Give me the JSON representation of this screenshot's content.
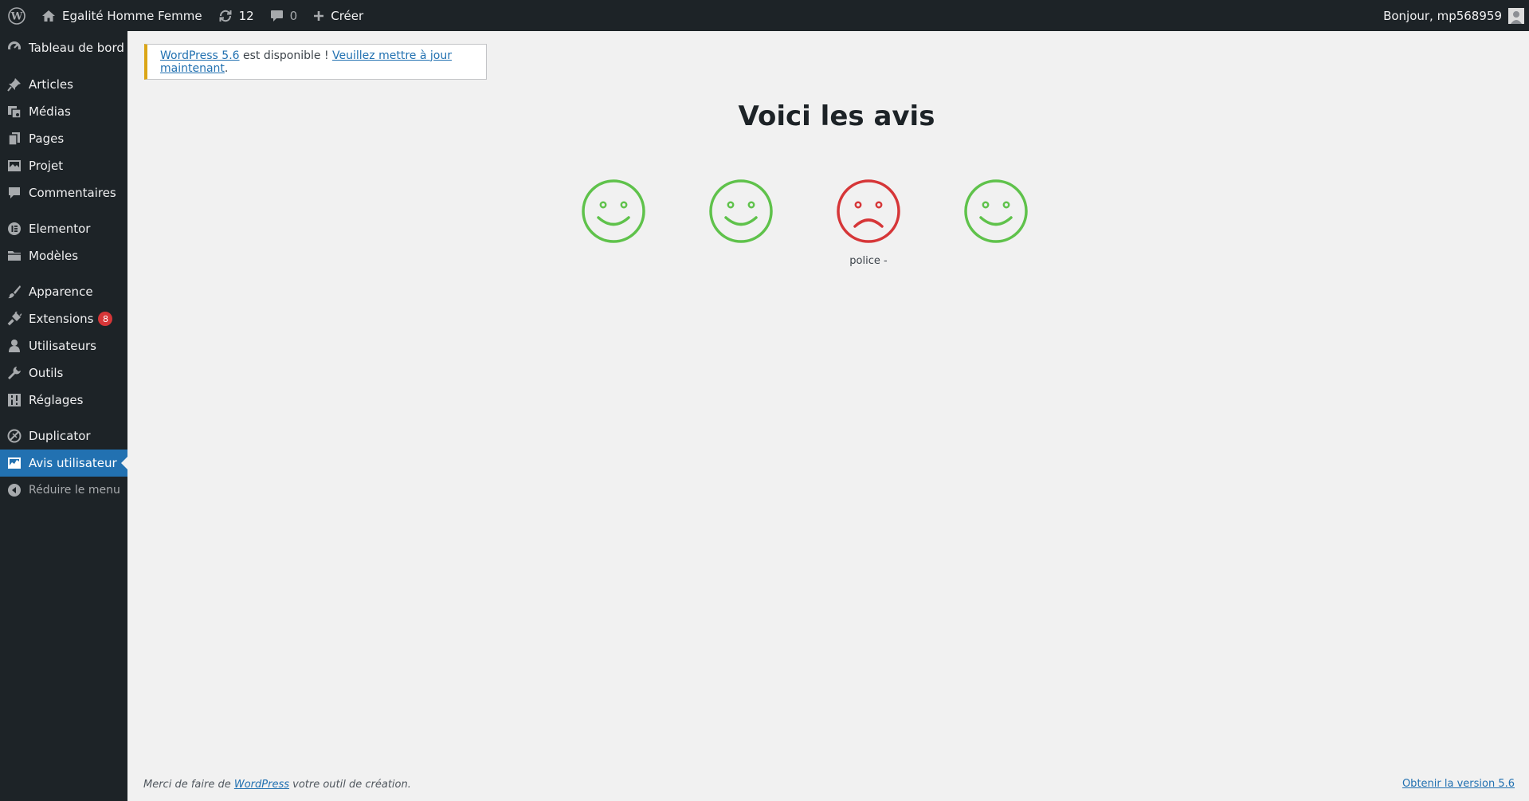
{
  "adminbar": {
    "site_name": "Egalité Homme Femme",
    "updates_count": "12",
    "comments_count": "0",
    "new_label": "Créer",
    "greeting": "Bonjour, mp568959"
  },
  "sidebar": {
    "items": [
      {
        "label": "Tableau de bord",
        "icon": "dashboard-icon"
      },
      {
        "label": "Articles",
        "icon": "pin-icon"
      },
      {
        "label": "Médias",
        "icon": "media-icon"
      },
      {
        "label": "Pages",
        "icon": "pages-icon"
      },
      {
        "label": "Projet",
        "icon": "portfolio-icon"
      },
      {
        "label": "Commentaires",
        "icon": "comment-icon"
      },
      {
        "label": "Elementor",
        "icon": "elementor-icon"
      },
      {
        "label": "Modèles",
        "icon": "folder-icon"
      },
      {
        "label": "Apparence",
        "icon": "brush-icon"
      },
      {
        "label": "Extensions",
        "icon": "plugin-icon",
        "badge": "8"
      },
      {
        "label": "Utilisateurs",
        "icon": "user-icon"
      },
      {
        "label": "Outils",
        "icon": "wrench-icon"
      },
      {
        "label": "Réglages",
        "icon": "settings-icon"
      },
      {
        "label": "Duplicator",
        "icon": "duplicator-icon"
      },
      {
        "label": "Avis utilisateur",
        "icon": "chart-icon",
        "current": true
      },
      {
        "label": "Réduire le menu",
        "icon": "collapse-icon"
      }
    ]
  },
  "notice": {
    "version_link": "WordPress 5.6",
    "middle_text": " est disponible ! ",
    "update_link": "Veuillez mettre à jour maintenant",
    "end": "."
  },
  "main": {
    "title": "Voici les avis",
    "smileys": [
      {
        "mood": "happy",
        "color": "#5fc24b",
        "caption": ""
      },
      {
        "mood": "happy",
        "color": "#5fc24b",
        "caption": ""
      },
      {
        "mood": "sad",
        "color": "#d63638",
        "caption": "police -"
      },
      {
        "mood": "happy",
        "color": "#5fc24b",
        "caption": ""
      }
    ]
  },
  "footer": {
    "left_prefix": "Merci de faire de ",
    "left_link": "WordPress",
    "left_suffix": " votre outil de création.",
    "right_link": "Obtenir la version 5.6"
  }
}
